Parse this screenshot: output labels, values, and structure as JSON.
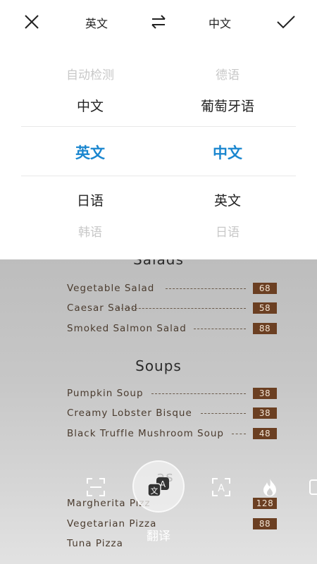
{
  "header": {
    "source_lang": "英文",
    "target_lang": "中文",
    "close_icon": "close-icon",
    "swap_icon": "swap-arrows-icon",
    "confirm_icon": "checkmark-icon"
  },
  "picker": {
    "source_options": [
      "自动检测",
      "中文",
      "英文",
      "日语",
      "韩语"
    ],
    "target_options": [
      "德语",
      "葡萄牙语",
      "中文",
      "英文",
      "日语"
    ],
    "selected_source": "英文",
    "selected_target": "中文",
    "accent_color": "#1a86cf"
  },
  "menu": {
    "sections": [
      {
        "title": "Salads",
        "items": [
          {
            "name": "Vegetable Salad",
            "price": "68"
          },
          {
            "name": "Caesar Salad",
            "price": "58"
          },
          {
            "name": "Smoked Salmon Salad",
            "price": "88"
          }
        ]
      },
      {
        "title": "Soups",
        "items": [
          {
            "name": "Pumpkin Soup",
            "price": "38"
          },
          {
            "name": "Creamy Lobster Bisque",
            "price": "38"
          },
          {
            "name": "Black Truffle Mushroom Soup",
            "price": "48"
          }
        ]
      },
      {
        "title": "as",
        "items": [
          {
            "name": "Margherita Pizz",
            "price": "128"
          },
          {
            "name": "Vegetarian Pizza",
            "price": "88"
          },
          {
            "name": "Tuna Pizza",
            "price": ""
          }
        ]
      }
    ]
  },
  "toolbar": {
    "translate_label": "翻译",
    "tools": [
      "scan-frame-icon",
      "translate-icon",
      "text-recognition-icon",
      "flame-icon",
      "partial-icon"
    ]
  }
}
